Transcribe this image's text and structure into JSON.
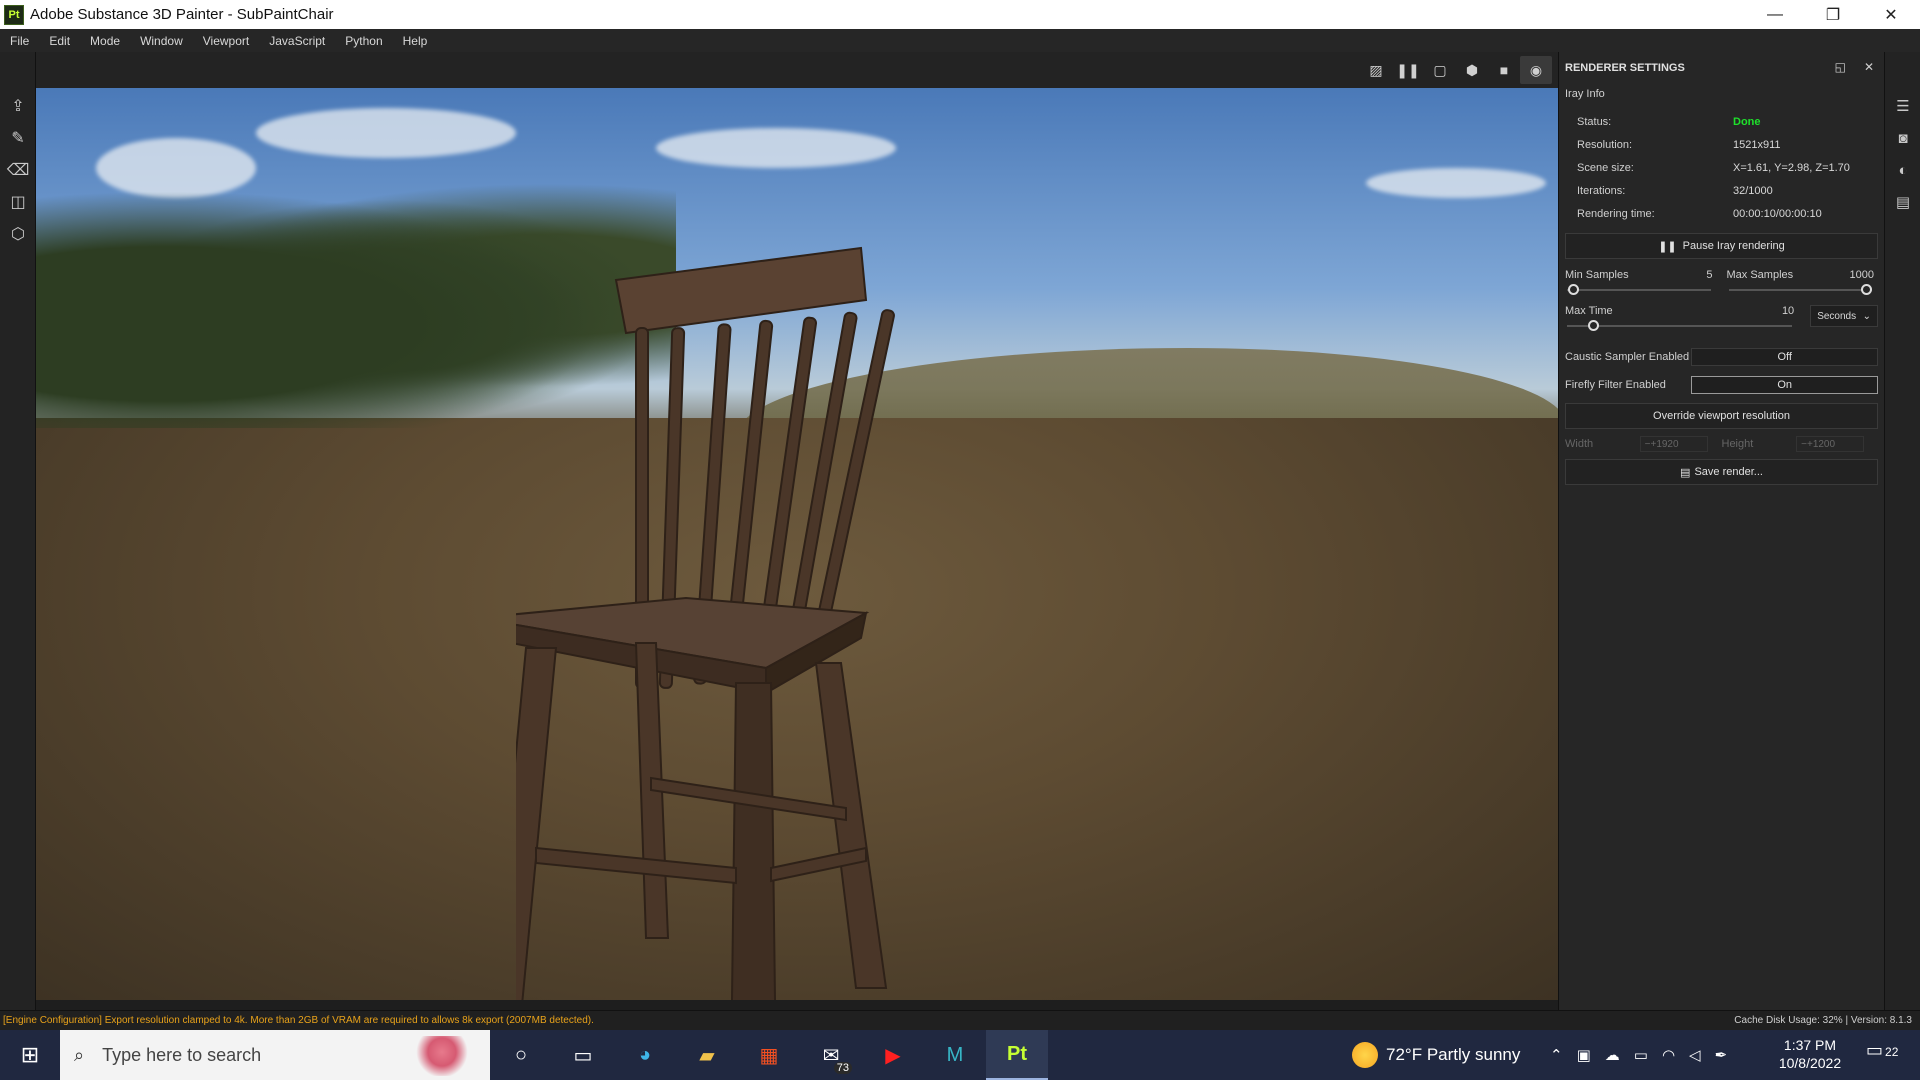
{
  "window": {
    "app_icon": "Pt",
    "title": "Adobe Substance 3D Painter - SubPaintChair",
    "minimize": "—",
    "maximize": "❐",
    "close": "✕"
  },
  "menu": [
    "File",
    "Edit",
    "Mode",
    "Window",
    "Viewport",
    "JavaScript",
    "Python",
    "Help"
  ],
  "renderer": {
    "panel_title": "RENDERER SETTINGS",
    "section": "Iray Info",
    "info": [
      {
        "k": "Status:",
        "v": "Done"
      },
      {
        "k": "Resolution:",
        "v": "1521x911"
      },
      {
        "k": "Scene size:",
        "v": "X=1.61, Y=2.98, Z=1.70"
      },
      {
        "k": "Iterations:",
        "v": "32/1000"
      },
      {
        "k": "Rendering time:",
        "v": "00:00:10/00:00:10"
      }
    ],
    "pause_button": "Pause Iray rendering",
    "min_samples_label": "Min Samples",
    "min_samples_value": "5",
    "max_samples_label": "Max Samples",
    "max_samples_value": "1000",
    "max_time_label": "Max Time",
    "max_time_value": "10",
    "max_time_unit": "Seconds",
    "caustic_label": "Caustic Sampler Enabled",
    "caustic_value": "Off",
    "firefly_label": "Firefly Filter Enabled",
    "firefly_value": "On",
    "override_button": "Override viewport resolution",
    "width_label": "Width",
    "width_value": "1920",
    "height_label": "Height",
    "height_value": "1200",
    "save_button": "Save render...",
    "min_samples_fraction": 0.005,
    "max_samples_fraction": 1.0,
    "max_time_fraction": 0.1
  },
  "status": {
    "message": "[Engine Configuration] Export resolution clamped to 4k. More than 2GB of VRAM are required to allows 8k export (2007MB detected).",
    "right": "Cache Disk Usage:    32% | Version: 8.1.3"
  },
  "taskbar": {
    "search_placeholder": "Type here to search",
    "mail_badge": "73",
    "weather": "72°F  Partly sunny",
    "time": "1:37 PM",
    "date": "10/8/2022",
    "notifications": "22"
  },
  "colors": {
    "status_done": "#1ee02b",
    "warning": "#e8a21a",
    "accent_pt": "#c6ff33"
  }
}
